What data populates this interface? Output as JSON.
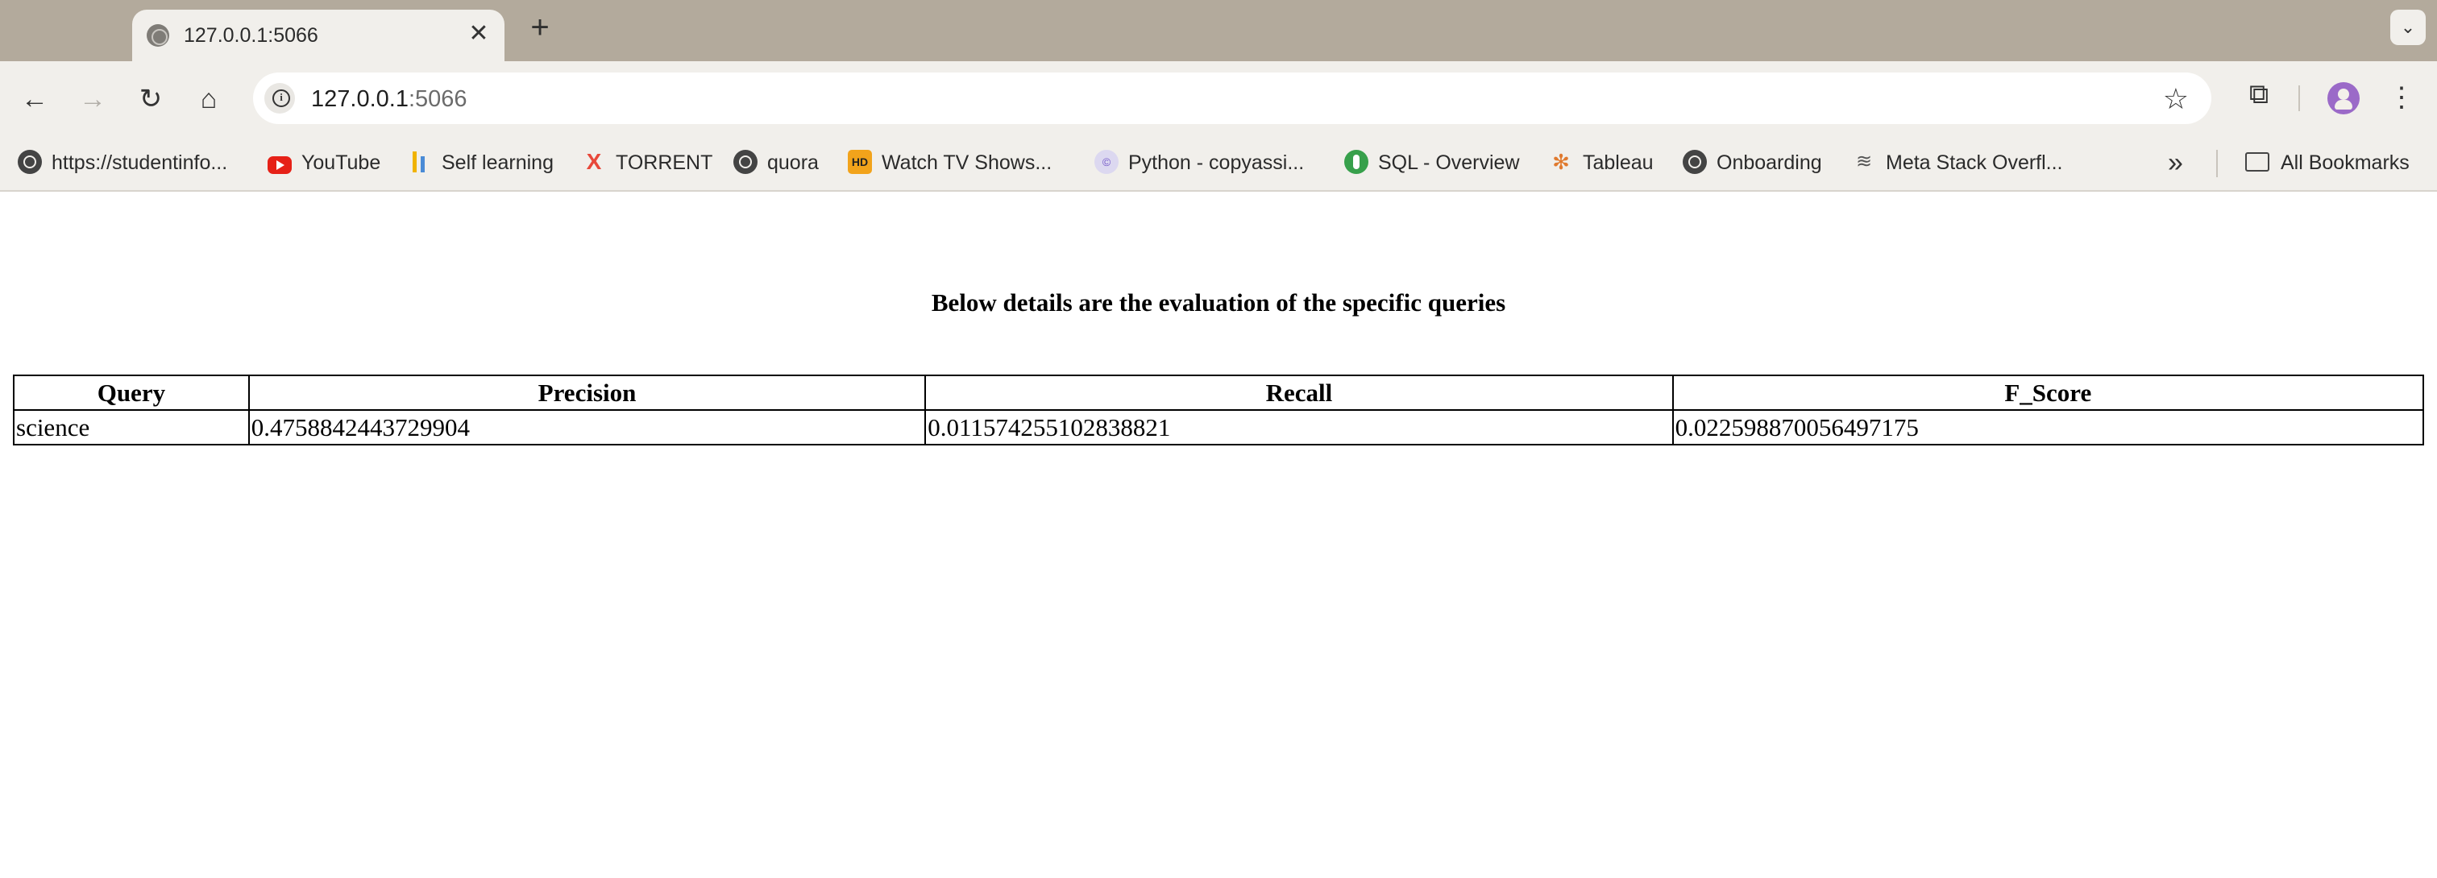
{
  "browser": {
    "tab": {
      "title": "127.0.0.1:5066",
      "close": "✕"
    },
    "new_tab": "+",
    "tab_search": "⌄",
    "nav": {
      "back": "←",
      "forward": "→",
      "reload": "↻",
      "home": "⌂"
    },
    "url": {
      "host": "127.0.0.1",
      "port": ":5066"
    },
    "star": "☆",
    "extensions": "⧉",
    "menu": "⋮",
    "bookmarks": [
      {
        "label": "https://studentinfo...",
        "icon": "globe-icon"
      },
      {
        "label": "YouTube",
        "icon": "youtube-icon"
      },
      {
        "label": "Self learning",
        "icon": "bars-icon"
      },
      {
        "label": "TORRENT",
        "icon": "torrent-icon"
      },
      {
        "label": "quora",
        "icon": "globe-icon"
      },
      {
        "label": "Watch TV Shows...",
        "icon": "hd-icon"
      },
      {
        "label": "Python - copyassi...",
        "icon": "python-icon"
      },
      {
        "label": "SQL - Overview",
        "icon": "sql-icon"
      },
      {
        "label": "Tableau",
        "icon": "tableau-icon"
      },
      {
        "label": "Onboarding",
        "icon": "globe-icon"
      },
      {
        "label": "Meta Stack Overfl...",
        "icon": "stackoverflow-icon"
      }
    ],
    "more_bookmarks": "»",
    "all_bookmarks": "All Bookmarks"
  },
  "page": {
    "heading": "Below details are the evaluation of the specific queries",
    "table": {
      "headers": [
        "Query",
        "Precision",
        "Recall",
        "F_Score"
      ],
      "rows": [
        [
          "science",
          "0.4758842443729904",
          "0.011574255102838821",
          "0.022598870056497175"
        ]
      ]
    }
  }
}
